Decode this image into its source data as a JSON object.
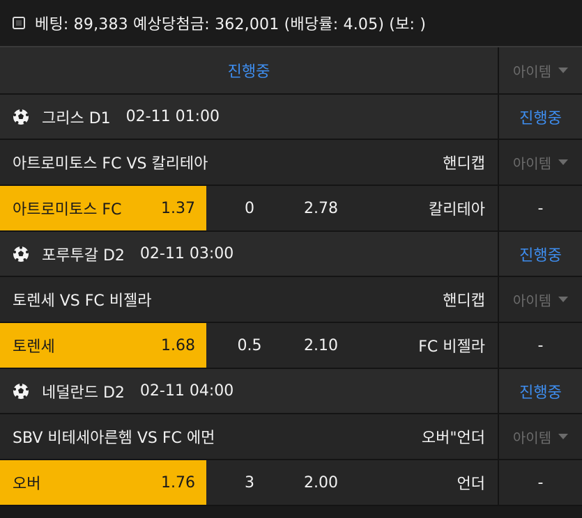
{
  "header": {
    "text": "베팅: 89,383 예상당첨금: 362,001 (배당률: 4.05) (보: )"
  },
  "topbar": {
    "status": "진행중",
    "item_label": "아이템"
  },
  "games": [
    {
      "league": "그리스 D1",
      "time": "02-11 01:00",
      "status": "진행중",
      "match": "아트로미토스 FC VS 칼리테아",
      "bet_type": "핸디캡",
      "item_label": "아이템",
      "home_pick": "아트로미토스 FC",
      "home_odd": "1.37",
      "handicap": "0",
      "away_odd": "2.78",
      "away_pick": "칼리테아",
      "side": "-"
    },
    {
      "league": "포루투갈 D2",
      "time": "02-11 03:00",
      "status": "진행중",
      "match": "토렌세 VS FC 비젤라",
      "bet_type": "핸디캡",
      "item_label": "아이템",
      "home_pick": "토렌세",
      "home_odd": "1.68",
      "handicap": "0.5",
      "away_odd": "2.10",
      "away_pick": "FC 비젤라",
      "side": "-"
    },
    {
      "league": "네덜란드 D2",
      "time": "02-11 04:00",
      "status": "진행중",
      "match": "SBV 비테세아른헴 VS FC 에먼",
      "bet_type": "오버\"언더",
      "item_label": "아이템",
      "home_pick": "오버",
      "home_odd": "1.76",
      "handicap": "3",
      "away_odd": "2.00",
      "away_pick": "언더",
      "side": "-"
    }
  ],
  "colors": {
    "accent_blue": "#3e8ef0",
    "pick_yellow": "#f7b500"
  }
}
